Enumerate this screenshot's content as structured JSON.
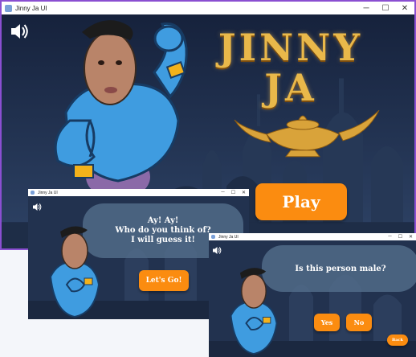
{
  "window_main": {
    "title": "Jinny Ja UI",
    "controls": {
      "minimize": "─",
      "maximize": "☐",
      "close": "✕"
    },
    "speaker_icon": "speaker-icon",
    "logo_line1": "JINNY",
    "logo_line2": "JA",
    "play_label": "Play"
  },
  "window_intro": {
    "title": "Jinny Ja UI",
    "controls": {
      "minimize": "─",
      "maximize": "☐",
      "close": "✕"
    },
    "speaker_icon": "speaker-icon",
    "speech_line1": "Ay! Ay!",
    "speech_line2": "Who do you think of?",
    "speech_line3": "I will guess it!",
    "start_label": "Let's Go!"
  },
  "window_question": {
    "title": "Jinny Ja UI",
    "controls": {
      "minimize": "─",
      "maximize": "☐",
      "close": "✕"
    },
    "speaker_icon": "speaker-icon",
    "question": "Is this person male?",
    "yes_label": "Yes",
    "no_label": "No",
    "back_label": "Back"
  },
  "colors": {
    "accent_orange": "#fb8c10",
    "gold": "#e9b84a",
    "genie_blue": "#4aa8e8",
    "night_sky": "#1d2a45",
    "window_border": "#8a4fd1"
  }
}
